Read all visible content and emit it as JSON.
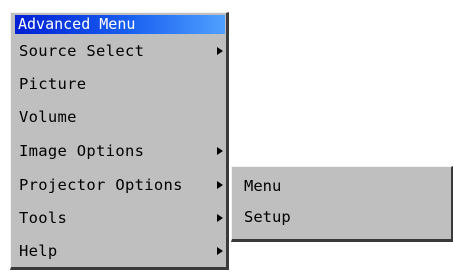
{
  "menu": {
    "title": "Advanced Menu",
    "items": [
      {
        "label": "Source Select",
        "has_submenu": true
      },
      {
        "label": "Picture",
        "has_submenu": false
      },
      {
        "label": "Volume",
        "has_submenu": false
      },
      {
        "label": "Image Options",
        "has_submenu": true
      },
      {
        "label": "Projector Options",
        "has_submenu": true
      },
      {
        "label": "Tools",
        "has_submenu": true
      },
      {
        "label": "Help",
        "has_submenu": true
      }
    ]
  },
  "submenu": {
    "parent": "Projector Options",
    "items": [
      {
        "label": "Menu"
      },
      {
        "label": "Setup"
      }
    ]
  },
  "colors": {
    "menu_background": "#bfbfbf",
    "title_gradient_start": "#001fd4",
    "title_gradient_end": "#4fa0ff",
    "title_text": "#ffffff"
  }
}
